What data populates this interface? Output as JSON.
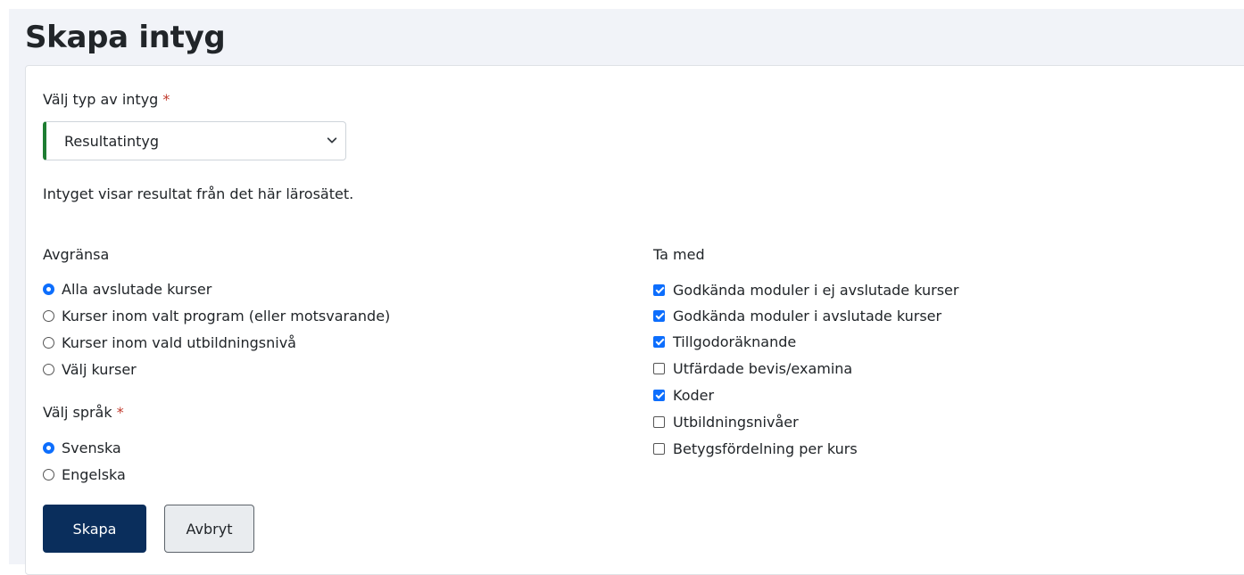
{
  "page": {
    "title": "Skapa intyg"
  },
  "type_field": {
    "label": "Välj typ av intyg",
    "required_mark": "*",
    "selected_value": "Resultatintyg",
    "description": "Intyget visar resultat från det här lärosätet.",
    "accent_color": "#1e7d32"
  },
  "limit": {
    "label": "Avgränsa",
    "options": [
      {
        "label": "Alla avslutade kurser",
        "checked": true
      },
      {
        "label": "Kurser inom valt program (eller motsvarande)",
        "checked": false
      },
      {
        "label": "Kurser inom vald utbildningsnivå",
        "checked": false
      },
      {
        "label": "Välj kurser",
        "checked": false
      }
    ]
  },
  "language": {
    "label": "Välj språk",
    "required_mark": "*",
    "options": [
      {
        "label": "Svenska",
        "checked": true
      },
      {
        "label": "Engelska",
        "checked": false
      }
    ]
  },
  "include": {
    "label": "Ta med",
    "options": [
      {
        "label": "Godkända moduler i ej avslutade kurser",
        "checked": true
      },
      {
        "label": "Godkända moduler i avslutade kurser",
        "checked": true
      },
      {
        "label": "Tillgodoräknande",
        "checked": true
      },
      {
        "label": "Utfärdade bevis/examina",
        "checked": false
      },
      {
        "label": "Koder",
        "checked": true
      },
      {
        "label": "Utbildningsnivåer",
        "checked": false
      },
      {
        "label": "Betygsfördelning per kurs",
        "checked": false
      }
    ]
  },
  "actions": {
    "create_label": "Skapa",
    "cancel_label": "Avbryt",
    "primary_color": "#0a2e5c"
  },
  "icons": {
    "select": "chevron-down-icon"
  }
}
